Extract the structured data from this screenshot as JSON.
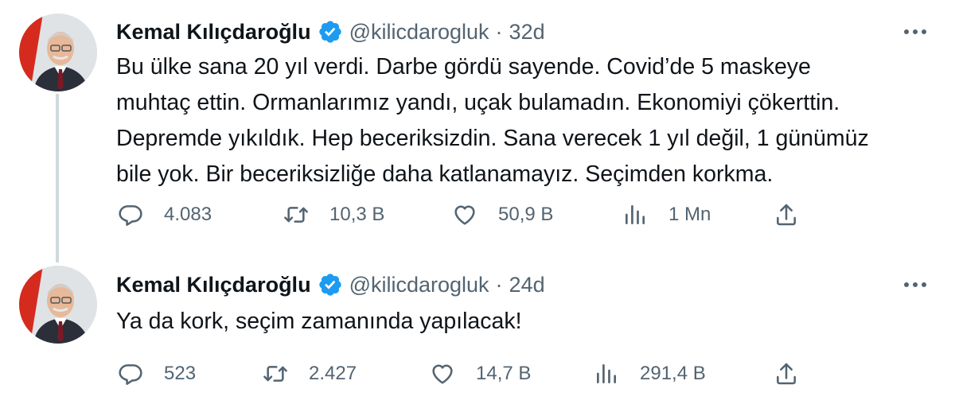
{
  "tweets": [
    {
      "author_name": "Kemal Kılıçdaroğlu",
      "handle": "@kilicdarogluk",
      "separator": "·",
      "time": "32d",
      "text": "Bu ülke sana 20 yıl verdi. Darbe gördü sayende. Covid’de 5 maskeye\nmuhtaç ettin. Ormanlarımız yandı, uçak bulamadın. Ekonomiyi çökerttin.\nDepremde yıkıldık. Hep beceriksizdin. Sana verecek 1 yıl değil, 1 günümüz\nbile yok. Bir beceriksizliğe daha katlanamayız. Seçimden korkma.",
      "replies": "4.083",
      "retweets": "10,3 B",
      "likes": "50,9 B",
      "views": "1 Mn"
    },
    {
      "author_name": "Kemal Kılıçdaroğlu",
      "handle": "@kilicdarogluk",
      "separator": "·",
      "time": "24d",
      "text": "Ya da kork, seçim zamanında yapılacak!",
      "replies": "523",
      "retweets": "2.427",
      "likes": "14,7 B",
      "views": "291,4 B"
    }
  ],
  "icons": {
    "reply": "reply-icon",
    "retweet": "retweet-icon",
    "like": "heart-icon",
    "views": "views-chart-icon",
    "share": "share-icon",
    "verified": "verified-badge-icon",
    "more": "more-options-icon"
  },
  "colors": {
    "text": "#0f1419",
    "secondary": "#536471",
    "verified": "#1d9bf0",
    "thread_line": "#cfd9de"
  }
}
